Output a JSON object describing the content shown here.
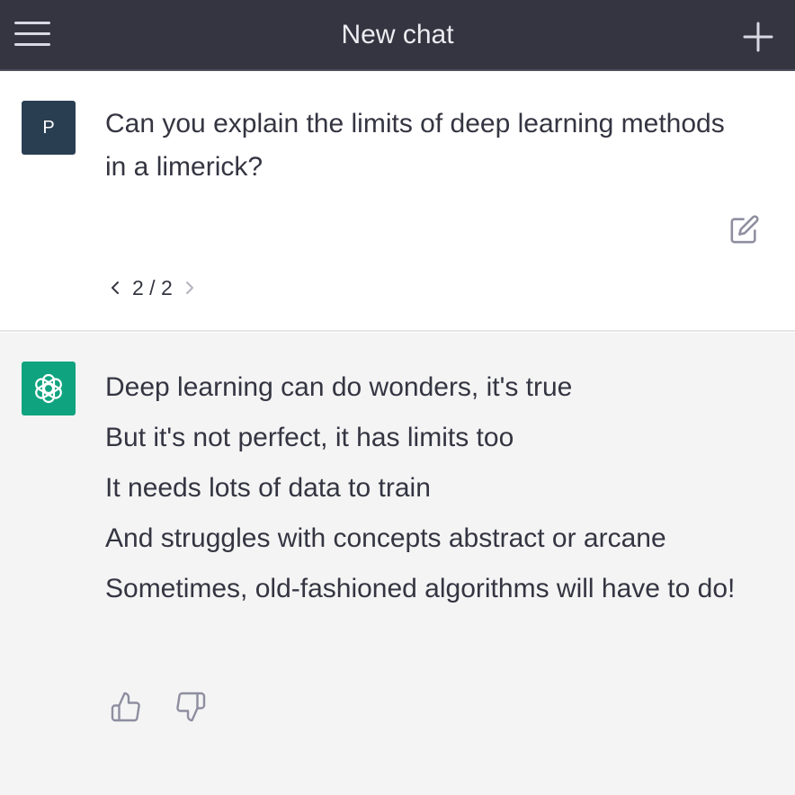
{
  "header": {
    "title": "New chat"
  },
  "user_message": {
    "avatar_initial": "P",
    "text": "Can you explain the limits of deep learning methods in a limerick?",
    "pager": "2 / 2"
  },
  "assistant_message": {
    "lines": [
      "Deep learning can do wonders, it's true",
      "But it's not perfect, it has limits too",
      "It needs lots of data to train",
      "And struggles with concepts abstract or arcane",
      "Sometimes, old-fashioned algorithms will have to do!"
    ]
  },
  "colors": {
    "header_bg": "#343541",
    "user_avatar_bg": "#2a3e52",
    "bot_avatar_bg": "#10a37f",
    "assistant_bg": "#f4f4f5"
  },
  "icons": {
    "menu": "hamburger-icon",
    "new_chat": "plus-icon",
    "edit": "edit-icon",
    "prev": "chevron-left-icon",
    "next": "chevron-right-icon",
    "bot_logo": "openai-logo-icon",
    "like": "thumbs-up-icon",
    "dislike": "thumbs-down-icon"
  }
}
